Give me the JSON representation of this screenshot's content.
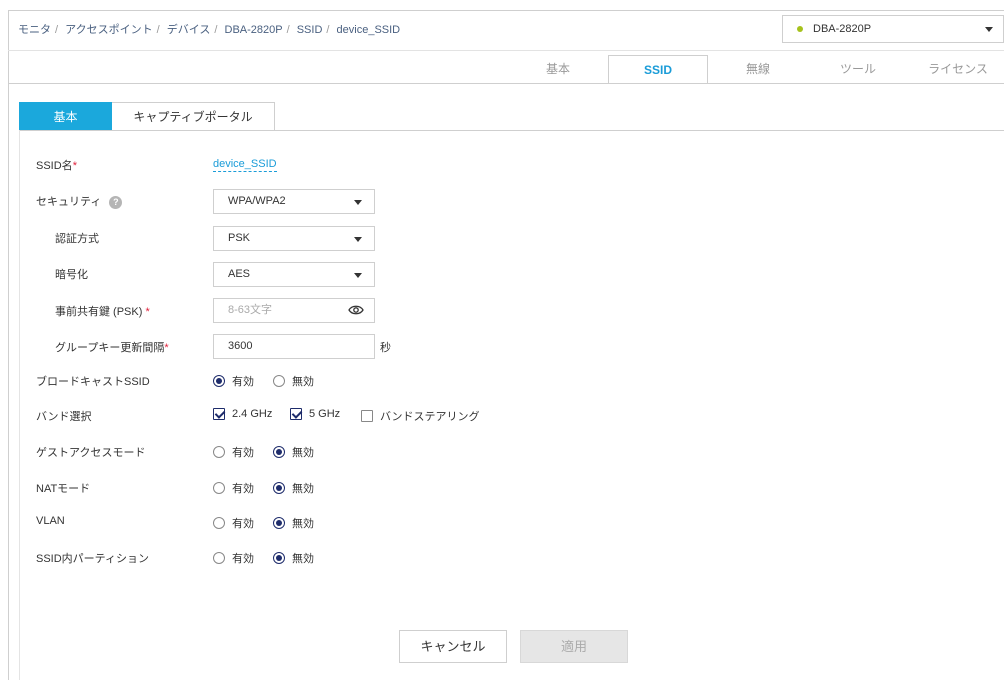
{
  "breadcrumb": [
    "モニタ",
    "アクセスポイント",
    "デバイス",
    "DBA-2820P",
    "SSID",
    "device_SSID"
  ],
  "device_selector": {
    "value": "DBA-2820P",
    "status_color": "#a6c21c"
  },
  "top_tabs": [
    {
      "label": "基本",
      "active": false
    },
    {
      "label": "SSID",
      "active": true
    },
    {
      "label": "無線",
      "active": false
    },
    {
      "label": "ツール",
      "active": false
    },
    {
      "label": "ライセンス",
      "active": false
    }
  ],
  "sub_tabs": [
    {
      "label": "基本",
      "active": true
    },
    {
      "label": "キャプティブポータル",
      "active": false
    }
  ],
  "form": {
    "ssid_name": {
      "label": "SSID名",
      "required": "*",
      "value": "device_SSID"
    },
    "security": {
      "label": "セキュリティ",
      "help": "?",
      "value": "WPA/WPA2"
    },
    "auth_method": {
      "label": "認証方式",
      "value": "PSK"
    },
    "encryption": {
      "label": "暗号化",
      "value": "AES"
    },
    "psk": {
      "label": "事前共有鍵 (PSK)",
      "required": "*",
      "placeholder": "8-63文字"
    },
    "group_key_interval": {
      "label": "グループキー更新間隔",
      "required": "*",
      "value": "3600",
      "unit": "秒"
    },
    "broadcast_ssid": {
      "label": "ブロードキャストSSID",
      "enabled_label": "有効",
      "disabled_label": "無効",
      "selected": "enabled"
    },
    "band_select": {
      "label": "バンド選択",
      "options": [
        "2.4 GHz",
        "5 GHz",
        "バンドステアリング"
      ],
      "checked": [
        true,
        true,
        false
      ]
    },
    "guest_access": {
      "label": "ゲストアクセスモード",
      "enabled_label": "有効",
      "disabled_label": "無効",
      "selected": "disabled"
    },
    "nat_mode": {
      "label": "NATモード",
      "enabled_label": "有効",
      "disabled_label": "無効",
      "selected": "disabled"
    },
    "vlan": {
      "label": "VLAN",
      "enabled_label": "有効",
      "disabled_label": "無効",
      "selected": "disabled"
    },
    "ssid_partition": {
      "label": "SSID内パーティション",
      "enabled_label": "有効",
      "disabled_label": "無効",
      "selected": "disabled"
    }
  },
  "buttons": {
    "cancel": "キャンセル",
    "apply": "適用"
  },
  "colors": {
    "accent": "#1ba8dc",
    "required": "#e0213b",
    "radio_selected": "#1e2c6b"
  }
}
